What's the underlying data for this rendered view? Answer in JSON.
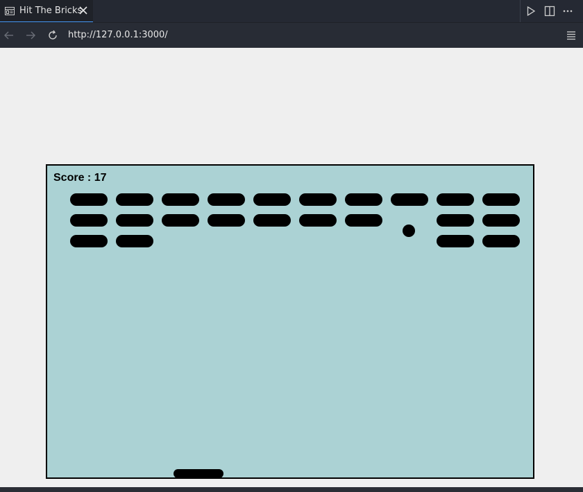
{
  "tab": {
    "title": "Hit The Bricks"
  },
  "address_bar": {
    "url": "http://127.0.0.1:3000/"
  },
  "game": {
    "score_label": "Score : 17",
    "bricks": [
      {
        "row": 0,
        "col": 0,
        "visible": true
      },
      {
        "row": 0,
        "col": 1,
        "visible": true
      },
      {
        "row": 0,
        "col": 2,
        "visible": true
      },
      {
        "row": 0,
        "col": 3,
        "visible": true
      },
      {
        "row": 0,
        "col": 4,
        "visible": true
      },
      {
        "row": 0,
        "col": 5,
        "visible": true
      },
      {
        "row": 0,
        "col": 6,
        "visible": true
      },
      {
        "row": 0,
        "col": 7,
        "visible": true
      },
      {
        "row": 0,
        "col": 8,
        "visible": true
      },
      {
        "row": 0,
        "col": 9,
        "visible": true
      },
      {
        "row": 1,
        "col": 0,
        "visible": true
      },
      {
        "row": 1,
        "col": 1,
        "visible": true
      },
      {
        "row": 1,
        "col": 2,
        "visible": true
      },
      {
        "row": 1,
        "col": 3,
        "visible": true
      },
      {
        "row": 1,
        "col": 4,
        "visible": true
      },
      {
        "row": 1,
        "col": 5,
        "visible": true
      },
      {
        "row": 1,
        "col": 6,
        "visible": true
      },
      {
        "row": 1,
        "col": 7,
        "visible": false
      },
      {
        "row": 1,
        "col": 8,
        "visible": true
      },
      {
        "row": 1,
        "col": 9,
        "visible": true
      },
      {
        "row": 2,
        "col": 0,
        "visible": true
      },
      {
        "row": 2,
        "col": 1,
        "visible": true
      },
      {
        "row": 2,
        "col": 2,
        "visible": false
      },
      {
        "row": 2,
        "col": 3,
        "visible": false
      },
      {
        "row": 2,
        "col": 4,
        "visible": false
      },
      {
        "row": 2,
        "col": 5,
        "visible": false
      },
      {
        "row": 2,
        "col": 6,
        "visible": false
      },
      {
        "row": 2,
        "col": 7,
        "visible": false
      },
      {
        "row": 2,
        "col": 8,
        "visible": true
      },
      {
        "row": 2,
        "col": 9,
        "visible": true
      }
    ],
    "colors": {
      "background": "#abd2d4",
      "foreground": "#000000"
    }
  },
  "icons": {
    "tab": "preview-icon",
    "close": "close-icon",
    "run": "play-icon",
    "split": "split-editor-icon",
    "more": "more-actions-icon",
    "back": "back-arrow-icon",
    "forward": "forward-arrow-icon",
    "reload": "reload-icon",
    "menu": "menu-icon"
  }
}
